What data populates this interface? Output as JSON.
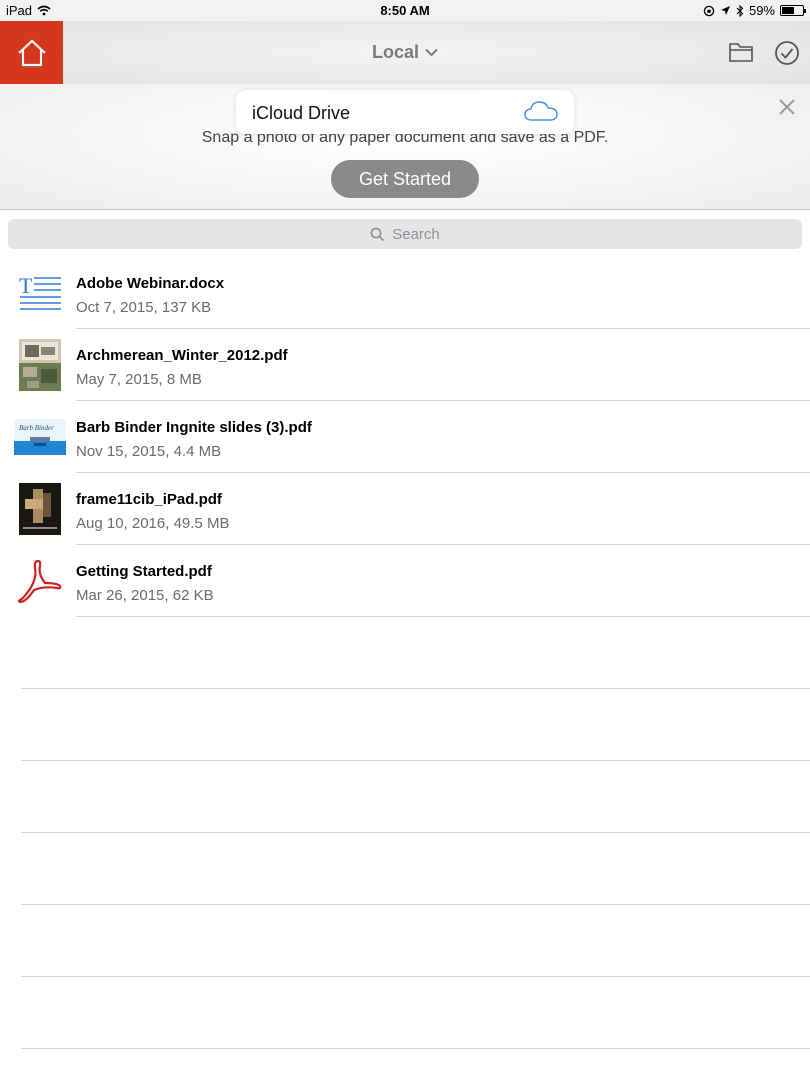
{
  "status_bar": {
    "device": "iPad",
    "time": "8:50 AM",
    "battery": "59%",
    "battery_level": 0.59
  },
  "top_bar": {
    "location": "Local",
    "icons": [
      "home-icon",
      "chevron-down-icon",
      "folder-icon",
      "checkmark-circle-icon"
    ]
  },
  "promo": {
    "message": "Snap a photo of any paper document and save as a PDF.",
    "button": "Get Started"
  },
  "popover": {
    "label": "iCloud Drive",
    "icon": "cloud-icon"
  },
  "search": {
    "placeholder": "Search"
  },
  "files": [
    {
      "name": "Adobe Webinar.docx",
      "meta": "Oct 7, 2015, 137 KB",
      "icon": "word-document-icon"
    },
    {
      "name": "Archmerean_Winter_2012.pdf",
      "meta": "May 7, 2015, 8 MB",
      "icon": "pdf-thumbnail-icon"
    },
    {
      "name": "Barb Binder Ingnite slides (3).pdf",
      "meta": "Nov 15, 2015, 4.4 MB",
      "icon": "pdf-thumbnail-icon",
      "thumb_text": "Barb Binder"
    },
    {
      "name": "frame11cib_iPad.pdf",
      "meta": "Aug 10, 2016, 49.5 MB",
      "icon": "pdf-thumbnail-icon"
    },
    {
      "name": "Getting Started.pdf",
      "meta": "Mar 26, 2015, 62 KB",
      "icon": "acrobat-pdf-icon"
    }
  ],
  "colors": {
    "accent": "#d5361c",
    "button_gray": "#8a8a8a",
    "meta_text": "#6b6b6b"
  }
}
